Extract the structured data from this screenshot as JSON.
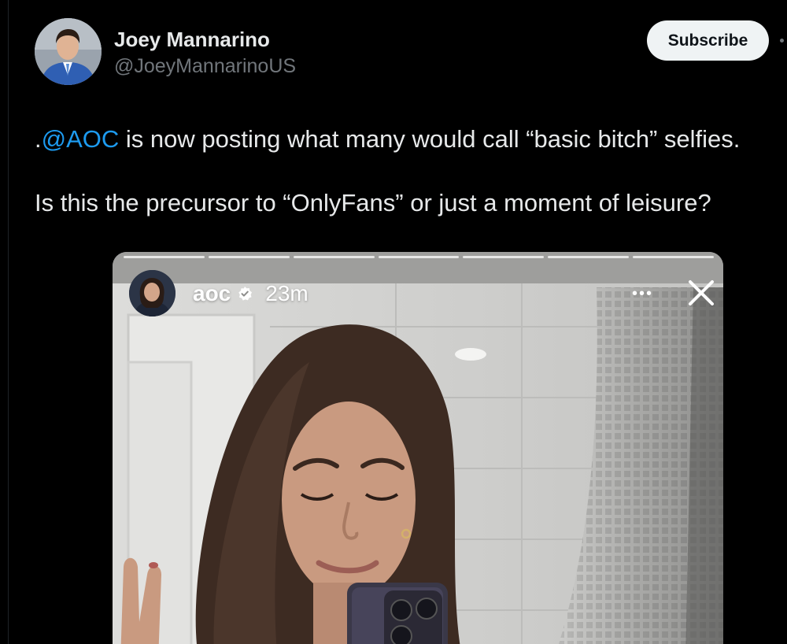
{
  "author": {
    "display_name": "Joey Mannarino",
    "handle": "@JoeyMannarinoUS",
    "avatar_icon": "profile-photo"
  },
  "header": {
    "subscribe_label": "Subscribe",
    "more_icon": "more-dot-icon"
  },
  "tweet": {
    "line1_prefix": ".",
    "line1_mention": "@AOC",
    "line1_rest": " is now posting what many would call “basic bitch” selfies.",
    "line2": "Is this the precursor to “OnlyFans” or just a moment of leisure?"
  },
  "media": {
    "type": "instagram-story-screenshot",
    "story": {
      "username": "aoc",
      "time": "23m",
      "verified": true,
      "progress_segments": 7,
      "more_icon": "ellipsis-icon",
      "close_icon": "close-icon",
      "avatar_icon": "story-avatar-photo"
    }
  },
  "colors": {
    "background": "#000000",
    "text_primary": "#e7e9ea",
    "text_secondary": "#71767b",
    "link": "#1d9bf0",
    "button_bg": "#eff3f4",
    "button_text": "#0f1419"
  }
}
